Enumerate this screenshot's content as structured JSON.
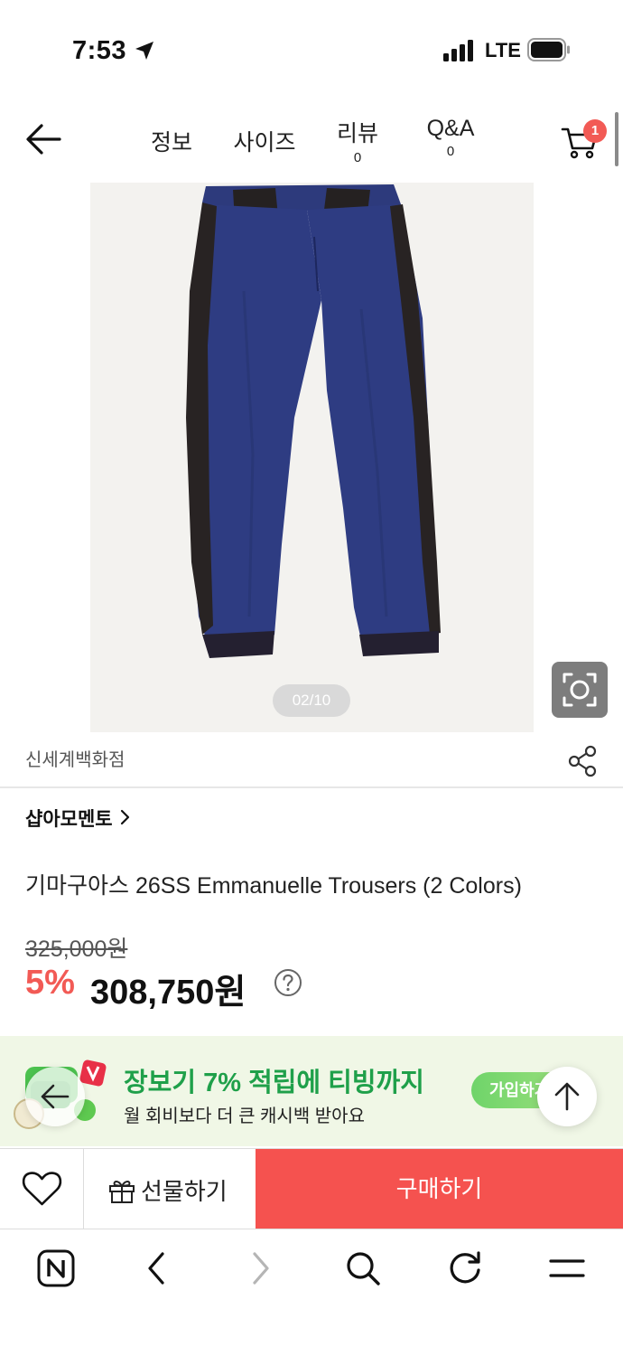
{
  "status": {
    "time": "7:53",
    "network": "LTE"
  },
  "nav": {
    "tabs": [
      {
        "label": "정보",
        "count": ""
      },
      {
        "label": "사이즈",
        "count": ""
      },
      {
        "label": "리뷰",
        "count": "0"
      },
      {
        "label": "Q&A",
        "count": "0"
      }
    ],
    "cart_count": "1"
  },
  "gallery": {
    "counter": "02/10"
  },
  "product": {
    "store": "신세계백화점",
    "brand": "샵아모멘토",
    "title": "기마구아스 26SS Emmanuelle Trousers (2 Colors)",
    "original_price": "325,000원",
    "discount": "5%",
    "price": "308,750원"
  },
  "banner": {
    "title": "장보기 7% 적립에 티빙까지",
    "subtitle": "월 회비보다 더 큰 캐시백 받아요",
    "join_label": "가입하기"
  },
  "actions": {
    "gift_label": "선물하기",
    "buy_label": "구매하기"
  },
  "icons": {
    "back": "arrow-left-icon",
    "cart": "cart-icon",
    "lens": "image-search-icon",
    "share": "share-icon",
    "help": "question-icon",
    "wish": "heart-icon",
    "gift": "gift-icon",
    "browser_home": "naver-n-icon",
    "browser_back": "chevron-left-icon",
    "browser_forward": "chevron-right-icon",
    "browser_search": "search-icon",
    "browser_reload": "reload-icon",
    "browser_menu": "menu-icon"
  },
  "colors": {
    "accent_red": "#f25a55",
    "buy_red": "#f5524f",
    "banner_green": "#1fa04a",
    "banner_bg": "#f0f7e6",
    "pants_blue": "#2e3c82",
    "pants_stripe": "#2b2626"
  }
}
